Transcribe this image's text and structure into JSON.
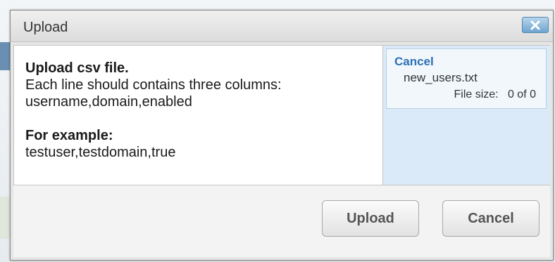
{
  "dialog": {
    "title": "Upload",
    "close_icon": "close-icon"
  },
  "instructions": {
    "heading": "Upload csv file.",
    "line1": "Each line should contains three columns:",
    "line2": "username,domain,enabled",
    "example_heading": "For example:",
    "example_value": "testuser,testdomain,true"
  },
  "upload_queue": {
    "cancel_label": "Cancel",
    "file_name": "new_users.txt",
    "file_size": "File size:   0 of 0"
  },
  "footer": {
    "upload_label": "Upload",
    "cancel_label": "Cancel"
  },
  "colors": {
    "link": "#2b6fb4",
    "panel": "#dbeaf8",
    "close_button": "#6ea4cf"
  }
}
